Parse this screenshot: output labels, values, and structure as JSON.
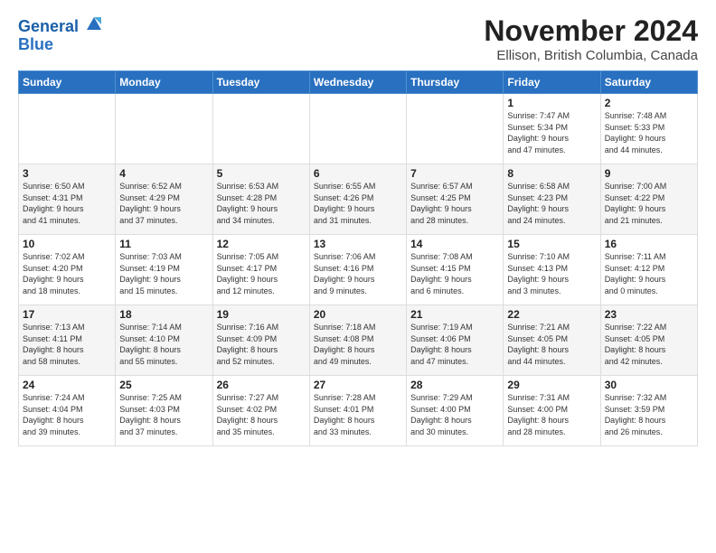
{
  "header": {
    "logo_line1": "General",
    "logo_line2": "Blue",
    "month": "November 2024",
    "location": "Ellison, British Columbia, Canada"
  },
  "weekdays": [
    "Sunday",
    "Monday",
    "Tuesday",
    "Wednesday",
    "Thursday",
    "Friday",
    "Saturday"
  ],
  "weeks": [
    [
      {
        "day": "",
        "info": ""
      },
      {
        "day": "",
        "info": ""
      },
      {
        "day": "",
        "info": ""
      },
      {
        "day": "",
        "info": ""
      },
      {
        "day": "",
        "info": ""
      },
      {
        "day": "1",
        "info": "Sunrise: 7:47 AM\nSunset: 5:34 PM\nDaylight: 9 hours\nand 47 minutes."
      },
      {
        "day": "2",
        "info": "Sunrise: 7:48 AM\nSunset: 5:33 PM\nDaylight: 9 hours\nand 44 minutes."
      }
    ],
    [
      {
        "day": "3",
        "info": "Sunrise: 6:50 AM\nSunset: 4:31 PM\nDaylight: 9 hours\nand 41 minutes."
      },
      {
        "day": "4",
        "info": "Sunrise: 6:52 AM\nSunset: 4:29 PM\nDaylight: 9 hours\nand 37 minutes."
      },
      {
        "day": "5",
        "info": "Sunrise: 6:53 AM\nSunset: 4:28 PM\nDaylight: 9 hours\nand 34 minutes."
      },
      {
        "day": "6",
        "info": "Sunrise: 6:55 AM\nSunset: 4:26 PM\nDaylight: 9 hours\nand 31 minutes."
      },
      {
        "day": "7",
        "info": "Sunrise: 6:57 AM\nSunset: 4:25 PM\nDaylight: 9 hours\nand 28 minutes."
      },
      {
        "day": "8",
        "info": "Sunrise: 6:58 AM\nSunset: 4:23 PM\nDaylight: 9 hours\nand 24 minutes."
      },
      {
        "day": "9",
        "info": "Sunrise: 7:00 AM\nSunset: 4:22 PM\nDaylight: 9 hours\nand 21 minutes."
      }
    ],
    [
      {
        "day": "10",
        "info": "Sunrise: 7:02 AM\nSunset: 4:20 PM\nDaylight: 9 hours\nand 18 minutes."
      },
      {
        "day": "11",
        "info": "Sunrise: 7:03 AM\nSunset: 4:19 PM\nDaylight: 9 hours\nand 15 minutes."
      },
      {
        "day": "12",
        "info": "Sunrise: 7:05 AM\nSunset: 4:17 PM\nDaylight: 9 hours\nand 12 minutes."
      },
      {
        "day": "13",
        "info": "Sunrise: 7:06 AM\nSunset: 4:16 PM\nDaylight: 9 hours\nand 9 minutes."
      },
      {
        "day": "14",
        "info": "Sunrise: 7:08 AM\nSunset: 4:15 PM\nDaylight: 9 hours\nand 6 minutes."
      },
      {
        "day": "15",
        "info": "Sunrise: 7:10 AM\nSunset: 4:13 PM\nDaylight: 9 hours\nand 3 minutes."
      },
      {
        "day": "16",
        "info": "Sunrise: 7:11 AM\nSunset: 4:12 PM\nDaylight: 9 hours\nand 0 minutes."
      }
    ],
    [
      {
        "day": "17",
        "info": "Sunrise: 7:13 AM\nSunset: 4:11 PM\nDaylight: 8 hours\nand 58 minutes."
      },
      {
        "day": "18",
        "info": "Sunrise: 7:14 AM\nSunset: 4:10 PM\nDaylight: 8 hours\nand 55 minutes."
      },
      {
        "day": "19",
        "info": "Sunrise: 7:16 AM\nSunset: 4:09 PM\nDaylight: 8 hours\nand 52 minutes."
      },
      {
        "day": "20",
        "info": "Sunrise: 7:18 AM\nSunset: 4:08 PM\nDaylight: 8 hours\nand 49 minutes."
      },
      {
        "day": "21",
        "info": "Sunrise: 7:19 AM\nSunset: 4:06 PM\nDaylight: 8 hours\nand 47 minutes."
      },
      {
        "day": "22",
        "info": "Sunrise: 7:21 AM\nSunset: 4:05 PM\nDaylight: 8 hours\nand 44 minutes."
      },
      {
        "day": "23",
        "info": "Sunrise: 7:22 AM\nSunset: 4:05 PM\nDaylight: 8 hours\nand 42 minutes."
      }
    ],
    [
      {
        "day": "24",
        "info": "Sunrise: 7:24 AM\nSunset: 4:04 PM\nDaylight: 8 hours\nand 39 minutes."
      },
      {
        "day": "25",
        "info": "Sunrise: 7:25 AM\nSunset: 4:03 PM\nDaylight: 8 hours\nand 37 minutes."
      },
      {
        "day": "26",
        "info": "Sunrise: 7:27 AM\nSunset: 4:02 PM\nDaylight: 8 hours\nand 35 minutes."
      },
      {
        "day": "27",
        "info": "Sunrise: 7:28 AM\nSunset: 4:01 PM\nDaylight: 8 hours\nand 33 minutes."
      },
      {
        "day": "28",
        "info": "Sunrise: 7:29 AM\nSunset: 4:00 PM\nDaylight: 8 hours\nand 30 minutes."
      },
      {
        "day": "29",
        "info": "Sunrise: 7:31 AM\nSunset: 4:00 PM\nDaylight: 8 hours\nand 28 minutes."
      },
      {
        "day": "30",
        "info": "Sunrise: 7:32 AM\nSunset: 3:59 PM\nDaylight: 8 hours\nand 26 minutes."
      }
    ]
  ]
}
